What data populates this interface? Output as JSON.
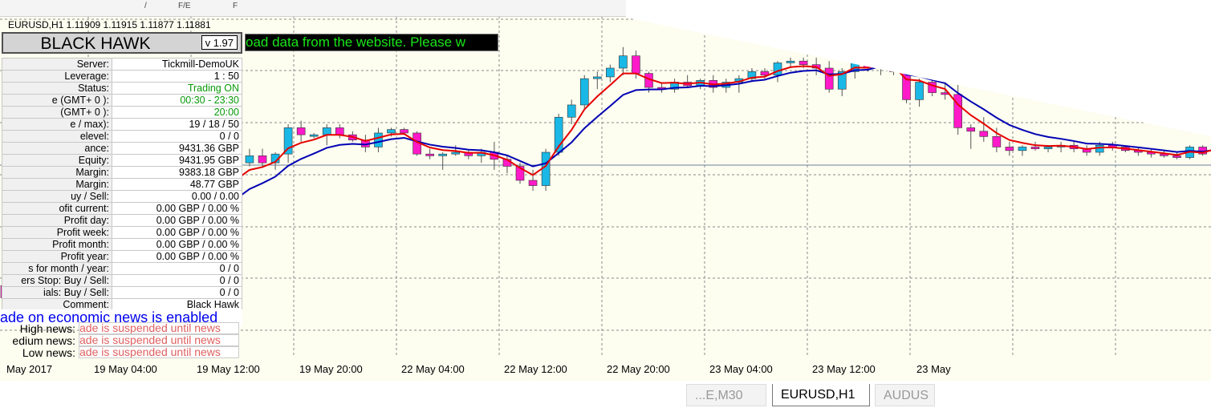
{
  "toolbar": {
    "fragments": [
      "/",
      "F/E",
      "F"
    ]
  },
  "symbol_line": "EURUSD,H1  1.11909 1.11915 1.11877 1.11881",
  "panel": {
    "title": "BLACK HAWK",
    "version": "v 1.97",
    "banner": "oad data from the website. Please w",
    "rows": [
      {
        "label": "Server:",
        "value": "Tickmill-DemoUK",
        "color": "black"
      },
      {
        "label": "Leverage:",
        "value": "1 : 50",
        "color": "black"
      },
      {
        "label": "Status:",
        "value": "Trading ON",
        "color": "green"
      },
      {
        "label": "e (GMT+ 0 ):",
        "value": "00:30 - 23:30",
        "color": "green"
      },
      {
        "label": "(GMT+ 0 ):",
        "value": "20:00",
        "color": "green"
      },
      {
        "label": "e / max):",
        "value": "19 / 18 / 50",
        "color": "black"
      },
      {
        "label": "elevel:",
        "value": "0 / 0",
        "color": "black"
      },
      {
        "label": "ance:",
        "value": "9431.36 GBP",
        "color": "black"
      },
      {
        "label": "Equity:",
        "value": "9431.95 GBP",
        "color": "black"
      },
      {
        "label": "Margin:",
        "value": "9383.18 GBP",
        "color": "black"
      },
      {
        "label": "Margin:",
        "value": "48.77 GBP",
        "color": "black"
      },
      {
        "label": "uy  /  Sell:",
        "value": "0.00  /  0.00",
        "color": "black"
      },
      {
        "label": "ofit current:",
        "value": "0.00 GBP / 0.00 %",
        "color": "black"
      },
      {
        "label": "Profit day:",
        "value": "0.00 GBP / 0.00 %",
        "color": "black"
      },
      {
        "label": "Profit week:",
        "value": "0.00 GBP / 0.00 %",
        "color": "black"
      },
      {
        "label": "Profit month:",
        "value": "0.00 GBP / 0.00 %",
        "color": "black"
      },
      {
        "label": "Profit year:",
        "value": "0.00 GBP / 0.00 %",
        "color": "black"
      },
      {
        "label": "s for month / year:",
        "value": "0  /  0",
        "color": "black"
      },
      {
        "label": "ers Stop: Buy / Sell:",
        "value": "0  /  0",
        "color": "black"
      },
      {
        "label": "ials: Buy / Sell:",
        "value": "0  /  0",
        "color": "black"
      },
      {
        "label": "Comment:",
        "value": "Black Hawk",
        "color": "black"
      }
    ],
    "news_banner": "ade on economic news is enabled",
    "news": [
      {
        "label": "High news:",
        "value": "ade is suspended until news"
      },
      {
        "label": "edium news:",
        "value": "ade is suspended until news"
      },
      {
        "label": "Low news:",
        "value": "ade is suspended until news"
      }
    ]
  },
  "xaxis": [
    "May 2017",
    "19 May 04:00",
    "19 May 12:00",
    "19 May 20:00",
    "22 May 04:00",
    "22 May 12:00",
    "22 May 20:00",
    "23 May 04:00",
    "23 May 12:00",
    "23 May"
  ],
  "tabs": [
    {
      "label": "...E,M30",
      "active": false
    },
    {
      "label": "EURUSD,H1",
      "active": true
    },
    {
      "label": "AUDUS",
      "active": false
    }
  ],
  "colors": {
    "bull": "#19b8e6",
    "bear": "#ff19c8",
    "ma_fast": "#e60000",
    "ma_slow": "#0000b4",
    "grid": "#8c8c8c",
    "background": "#fdfdf0"
  },
  "candles": [
    {
      "o": 1.1165,
      "h": 1.1169,
      "l": 1.1156,
      "c": 1.11615
    },
    {
      "o": 1.11615,
      "h": 1.1172,
      "l": 1.1159,
      "c": 1.11705
    },
    {
      "o": 1.11705,
      "h": 1.1172,
      "l": 1.1164,
      "c": 1.1166
    },
    {
      "o": 1.1166,
      "h": 1.1167,
      "l": 1.1165,
      "c": 1.11655
    },
    {
      "o": 1.11655,
      "h": 1.1169,
      "l": 1.1164,
      "c": 1.1168
    },
    {
      "o": 1.1168,
      "h": 1.117,
      "l": 1.1167,
      "c": 1.1169
    },
    {
      "o": 1.1169,
      "h": 1.1171,
      "l": 1.1167,
      "c": 1.11685
    },
    {
      "o": 1.11685,
      "h": 1.1169,
      "l": 1.1165,
      "c": 1.11665
    },
    {
      "o": 1.11665,
      "h": 1.117,
      "l": 1.1164,
      "c": 1.1169
    },
    {
      "o": 1.1169,
      "h": 1.1172,
      "l": 1.1168,
      "c": 1.1171
    },
    {
      "o": 1.1171,
      "h": 1.1173,
      "l": 1.117,
      "c": 1.1172
    },
    {
      "o": 1.1172,
      "h": 1.1177,
      "l": 1.117,
      "c": 1.11765
    },
    {
      "o": 1.11765,
      "h": 1.1183,
      "l": 1.1175,
      "c": 1.11825
    },
    {
      "o": 1.11825,
      "h": 1.1187,
      "l": 1.1181,
      "c": 1.1186
    },
    {
      "o": 1.1186,
      "h": 1.1189,
      "l": 1.1185,
      "c": 1.1188
    },
    {
      "o": 1.1188,
      "h": 1.1193,
      "l": 1.1187,
      "c": 1.11915
    },
    {
      "o": 1.11915,
      "h": 1.1195,
      "l": 1.119,
      "c": 1.1194
    },
    {
      "o": 1.1194,
      "h": 1.1198,
      "l": 1.1192,
      "c": 1.1196
    },
    {
      "o": 1.1196,
      "h": 1.1201,
      "l": 1.1195,
      "c": 1.12
    },
    {
      "o": 1.12,
      "h": 1.1204,
      "l": 1.1199,
      "c": 1.1202
    },
    {
      "o": 1.1202,
      "h": 1.1204,
      "l": 1.1199,
      "c": 1.12
    },
    {
      "o": 1.12,
      "h": 1.1203,
      "l": 1.1198,
      "c": 1.12025
    },
    {
      "o": 1.12025,
      "h": 1.1211,
      "l": 1.12,
      "c": 1.121
    },
    {
      "o": 1.121,
      "h": 1.1212,
      "l": 1.1206,
      "c": 1.1208
    },
    {
      "o": 1.1208,
      "h": 1.12085,
      "l": 1.1207,
      "c": 1.1208
    },
    {
      "o": 1.1208,
      "h": 1.1211,
      "l": 1.1205,
      "c": 1.121
    },
    {
      "o": 1.121,
      "h": 1.1211,
      "l": 1.1207,
      "c": 1.1208
    },
    {
      "o": 1.1208,
      "h": 1.1209,
      "l": 1.1206,
      "c": 1.12065
    },
    {
      "o": 1.12065,
      "h": 1.1208,
      "l": 1.1203,
      "c": 1.12045
    },
    {
      "o": 1.12045,
      "h": 1.121,
      "l": 1.1203,
      "c": 1.12085
    },
    {
      "o": 1.12085,
      "h": 1.121,
      "l": 1.12075,
      "c": 1.12095
    },
    {
      "o": 1.12095,
      "h": 1.121,
      "l": 1.1208,
      "c": 1.12085
    },
    {
      "o": 1.12085,
      "h": 1.1209,
      "l": 1.1202,
      "c": 1.12025
    },
    {
      "o": 1.12025,
      "h": 1.1204,
      "l": 1.1201,
      "c": 1.1202
    },
    {
      "o": 1.1202,
      "h": 1.1203,
      "l": 1.1198,
      "c": 1.12025
    },
    {
      "o": 1.12025,
      "h": 1.1205,
      "l": 1.1202,
      "c": 1.1203
    },
    {
      "o": 1.1203,
      "h": 1.12035,
      "l": 1.1201,
      "c": 1.1202
    },
    {
      "o": 1.1202,
      "h": 1.1204,
      "l": 1.12,
      "c": 1.1203
    },
    {
      "o": 1.1203,
      "h": 1.1206,
      "l": 1.1198,
      "c": 1.1201
    },
    {
      "o": 1.1201,
      "h": 1.1202,
      "l": 1.1197,
      "c": 1.1199
    },
    {
      "o": 1.1199,
      "h": 1.12,
      "l": 1.1194,
      "c": 1.1195
    },
    {
      "o": 1.1195,
      "h": 1.1198,
      "l": 1.1192,
      "c": 1.11935
    },
    {
      "o": 1.11935,
      "h": 1.1204,
      "l": 1.1192,
      "c": 1.1203
    },
    {
      "o": 1.1203,
      "h": 1.1214,
      "l": 1.1202,
      "c": 1.1213
    },
    {
      "o": 1.1213,
      "h": 1.1218,
      "l": 1.1211,
      "c": 1.12165
    },
    {
      "o": 1.12165,
      "h": 1.1225,
      "l": 1.1215,
      "c": 1.1224
    },
    {
      "o": 1.1224,
      "h": 1.1226,
      "l": 1.1221,
      "c": 1.12245
    },
    {
      "o": 1.12245,
      "h": 1.1228,
      "l": 1.1223,
      "c": 1.1227
    },
    {
      "o": 1.1227,
      "h": 1.1233,
      "l": 1.1225,
      "c": 1.12305
    },
    {
      "o": 1.12305,
      "h": 1.1232,
      "l": 1.1224,
      "c": 1.12255
    },
    {
      "o": 1.12255,
      "h": 1.1226,
      "l": 1.122,
      "c": 1.12215
    },
    {
      "o": 1.12215,
      "h": 1.1223,
      "l": 1.122,
      "c": 1.1221
    },
    {
      "o": 1.1221,
      "h": 1.1224,
      "l": 1.122,
      "c": 1.1223
    },
    {
      "o": 1.1223,
      "h": 1.1225,
      "l": 1.12215,
      "c": 1.1222
    },
    {
      "o": 1.1222,
      "h": 1.1224,
      "l": 1.1221,
      "c": 1.12235
    },
    {
      "o": 1.12235,
      "h": 1.1225,
      "l": 1.122,
      "c": 1.12215
    },
    {
      "o": 1.12215,
      "h": 1.1224,
      "l": 1.122,
      "c": 1.1223
    },
    {
      "o": 1.1223,
      "h": 1.1225,
      "l": 1.122,
      "c": 1.1224
    },
    {
      "o": 1.1224,
      "h": 1.1227,
      "l": 1.1223,
      "c": 1.1226
    },
    {
      "o": 1.1226,
      "h": 1.1227,
      "l": 1.1224,
      "c": 1.1225
    },
    {
      "o": 1.1225,
      "h": 1.1229,
      "l": 1.1223,
      "c": 1.12285
    },
    {
      "o": 1.12285,
      "h": 1.123,
      "l": 1.1227,
      "c": 1.1229
    },
    {
      "o": 1.1229,
      "h": 1.123,
      "l": 1.1227,
      "c": 1.1228
    },
    {
      "o": 1.1228,
      "h": 1.123,
      "l": 1.1225,
      "c": 1.1227
    },
    {
      "o": 1.1227,
      "h": 1.1229,
      "l": 1.122,
      "c": 1.1221
    },
    {
      "o": 1.1221,
      "h": 1.1227,
      "l": 1.1219,
      "c": 1.1226
    },
    {
      "o": 1.1226,
      "h": 1.1233,
      "l": 1.1224,
      "c": 1.123
    },
    {
      "o": 1.123,
      "h": 1.1231,
      "l": 1.1226,
      "c": 1.1227
    },
    {
      "o": 1.1227,
      "h": 1.1232,
      "l": 1.1225,
      "c": 1.1231
    },
    {
      "o": 1.1231,
      "h": 1.1232,
      "l": 1.1225,
      "c": 1.1226
    },
    {
      "o": 1.1226,
      "h": 1.1227,
      "l": 1.1217,
      "c": 1.1218
    },
    {
      "o": 1.1218,
      "h": 1.1224,
      "l": 1.1216,
      "c": 1.1223
    },
    {
      "o": 1.1223,
      "h": 1.1224,
      "l": 1.1219,
      "c": 1.122
    },
    {
      "o": 1.122,
      "h": 1.1223,
      "l": 1.1218,
      "c": 1.12195
    },
    {
      "o": 1.12195,
      "h": 1.1225,
      "l": 1.1208,
      "c": 1.121
    },
    {
      "o": 1.121,
      "h": 1.1211,
      "l": 1.1204,
      "c": 1.1209
    },
    {
      "o": 1.1209,
      "h": 1.1213,
      "l": 1.1206,
      "c": 1.12075
    },
    {
      "o": 1.12075,
      "h": 1.121,
      "l": 1.1203,
      "c": 1.12045
    },
    {
      "o": 1.12045,
      "h": 1.1206,
      "l": 1.1202,
      "c": 1.12035
    },
    {
      "o": 1.12035,
      "h": 1.1205,
      "l": 1.1202,
      "c": 1.12045
    },
    {
      "o": 1.12045,
      "h": 1.1206,
      "l": 1.12035,
      "c": 1.1204
    },
    {
      "o": 1.1204,
      "h": 1.1205,
      "l": 1.1203,
      "c": 1.12045
    },
    {
      "o": 1.12045,
      "h": 1.1206,
      "l": 1.1203,
      "c": 1.1205
    },
    {
      "o": 1.1205,
      "h": 1.1206,
      "l": 1.1203,
      "c": 1.1204
    },
    {
      "o": 1.1204,
      "h": 1.1205,
      "l": 1.1202,
      "c": 1.1203
    },
    {
      "o": 1.1203,
      "h": 1.1206,
      "l": 1.1202,
      "c": 1.1205
    },
    {
      "o": 1.1205,
      "h": 1.1206,
      "l": 1.12035,
      "c": 1.12045
    },
    {
      "o": 1.12045,
      "h": 1.1205,
      "l": 1.1203,
      "c": 1.12035
    },
    {
      "o": 1.12035,
      "h": 1.12045,
      "l": 1.1202,
      "c": 1.1203
    },
    {
      "o": 1.1203,
      "h": 1.1204,
      "l": 1.12015,
      "c": 1.12025
    },
    {
      "o": 1.12025,
      "h": 1.12035,
      "l": 1.12015,
      "c": 1.1202
    },
    {
      "o": 1.1202,
      "h": 1.1203,
      "l": 1.1201,
      "c": 1.12015
    },
    {
      "o": 1.12015,
      "h": 1.1205,
      "l": 1.1201,
      "c": 1.12045
    },
    {
      "o": 1.12045,
      "h": 1.1205,
      "l": 1.1202,
      "c": 1.12025
    },
    {
      "o": 1.12025,
      "h": 1.1206,
      "l": 1.1202,
      "c": 1.12055
    },
    {
      "o": 1.12055,
      "h": 1.1206,
      "l": 1.12045,
      "c": 1.1205
    }
  ]
}
